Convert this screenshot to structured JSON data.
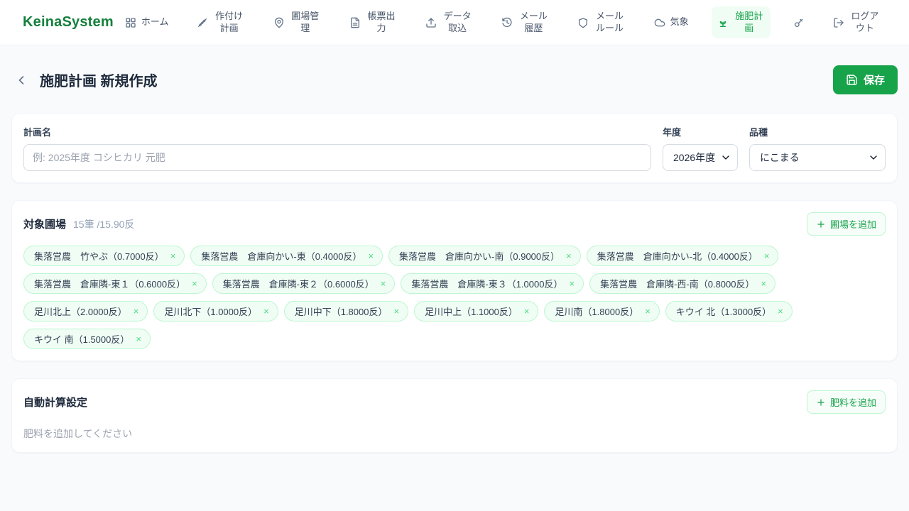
{
  "brand": {
    "name": "KeinaSystem"
  },
  "nav": {
    "items": [
      {
        "id": "home",
        "label": "ホーム",
        "icon": "grid-icon",
        "active": false
      },
      {
        "id": "planting-plan",
        "label": "作付け計画",
        "icon": "wheat-icon",
        "active": false
      },
      {
        "id": "field-management",
        "label": "圃場管理",
        "icon": "map-pin-icon",
        "active": false
      },
      {
        "id": "report-output",
        "label": "帳票出力",
        "icon": "document-icon",
        "active": false
      },
      {
        "id": "data-import",
        "label": "データ取込",
        "icon": "upload-icon",
        "active": false
      },
      {
        "id": "mail-history",
        "label": "メール履歴",
        "icon": "history-icon",
        "active": false
      },
      {
        "id": "mail-rules",
        "label": "メールルール",
        "icon": "shield-icon",
        "active": false
      },
      {
        "id": "weather",
        "label": "気象",
        "icon": "cloud-icon",
        "active": false
      },
      {
        "id": "fertilization-plan",
        "label": "施肥計画",
        "icon": "sprout-icon",
        "active": true
      },
      {
        "id": "password-key",
        "label": "",
        "icon": "key-icon",
        "active": false
      },
      {
        "id": "logout",
        "label": "ログアウト",
        "icon": "logout-icon",
        "active": false
      }
    ]
  },
  "header": {
    "title": "施肥計画 新規作成",
    "back_icon": "chevron-left-icon",
    "save_icon": "save-icon",
    "save_label": "保存"
  },
  "plan_form": {
    "plan_name": {
      "label": "計画名",
      "placeholder": "例: 2025年度 コシヒカリ 元肥",
      "value": ""
    },
    "year": {
      "label": "年度",
      "selected": "2026年度",
      "chevron_icon": "chevron-down-icon"
    },
    "variety": {
      "label": "品種",
      "selected": "にこまる",
      "chevron_icon": "chevron-down-icon"
    }
  },
  "fields_section": {
    "title": "対象圃場",
    "summary": "15筆 /15.90反",
    "add_button_icon": "plus-icon",
    "add_button_label": "圃場を追加",
    "remove_label": "×",
    "chips": [
      "集落営農　竹やぶ（0.7000反）",
      "集落営農　倉庫向かい-東（0.4000反）",
      "集落営農　倉庫向かい-南（0.9000反）",
      "集落営農　倉庫向かい-北（0.4000反）",
      "集落営農　倉庫隣-東１（0.6000反）",
      "集落営農　倉庫隣-東２（0.6000反）",
      "集落営農　倉庫隣-東３（1.0000反）",
      "集落営農　倉庫隣-西-南（0.8000反）",
      "足川北上（2.0000反）",
      "足川北下（1.0000反）",
      "足川中下（1.8000反）",
      "足川中上（1.1000反）",
      "足川南（1.8000反）",
      "キウイ 北（1.3000反）",
      "キウイ 南（1.5000反）"
    ]
  },
  "auto_calc_section": {
    "title": "自動計算設定",
    "add_button_icon": "plus-icon",
    "add_button_label": "肥料を追加",
    "empty_message": "肥料を追加してください"
  },
  "colors": {
    "brand_green": "#15803d",
    "accent_green": "#16a34a",
    "active_nav_bg": "#f0fdf4",
    "chip_bg": "#f0fdf4",
    "chip_border": "#bbf7d0",
    "page_bg": "#f8fafc"
  }
}
